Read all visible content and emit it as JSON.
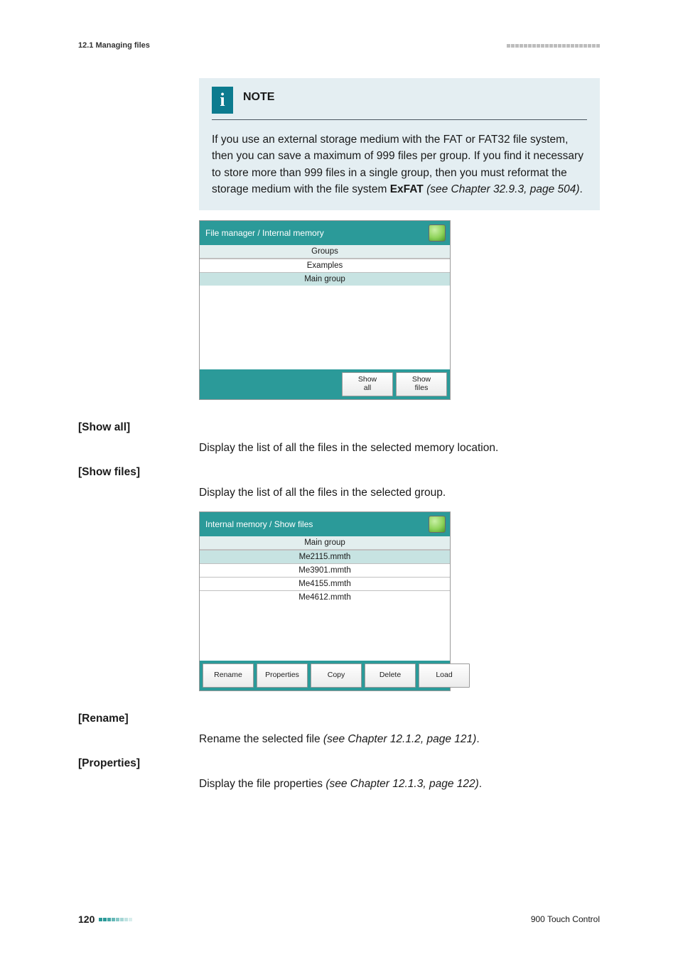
{
  "header": {
    "section_left": "12.1 Managing files"
  },
  "note": {
    "title": "NOTE",
    "body_part1": "If you use an external storage medium with the FAT or FAT32 file system, then you can save a maximum of 999 files per group. If you find it necessary to store more than 999 files in a single group, then you must reformat the storage medium with the file system ",
    "body_bold": "ExFAT",
    "body_ital": " (see Chapter 32.9.3, page 504)",
    "body_end": "."
  },
  "ui1": {
    "title": "File manager / Internal memory",
    "header_cell": "Groups",
    "rows": [
      "Examples",
      "Main group"
    ],
    "footer_buttons": [
      {
        "line1": "Show",
        "line2": "all"
      },
      {
        "line1": "Show",
        "line2": "files"
      }
    ]
  },
  "terms": {
    "show_all": {
      "label": "[Show all]",
      "body": "Display the list of all the files in the selected memory location."
    },
    "show_files": {
      "label": "[Show files]",
      "body": "Display the list of all the files in the selected group."
    },
    "rename": {
      "label": "[Rename]",
      "body_pre": "Rename the selected file ",
      "body_ital": "(see Chapter 12.1.2, page 121)",
      "body_post": "."
    },
    "properties": {
      "label": "[Properties]",
      "body_pre": "Display the file properties ",
      "body_ital": "(see Chapter 12.1.3, page 122)",
      "body_post": "."
    }
  },
  "ui2": {
    "title": "Internal memory / Show files",
    "header_cell": "Main group",
    "rows": [
      "Me2115.mmth",
      "Me3901.mmth",
      "Me4155.mmth",
      "Me4612.mmth"
    ],
    "footer_buttons": [
      "Rename",
      "Properties",
      "Copy",
      "Delete",
      "Load"
    ]
  },
  "footer": {
    "page_number": "120",
    "product": "900 Touch Control"
  }
}
